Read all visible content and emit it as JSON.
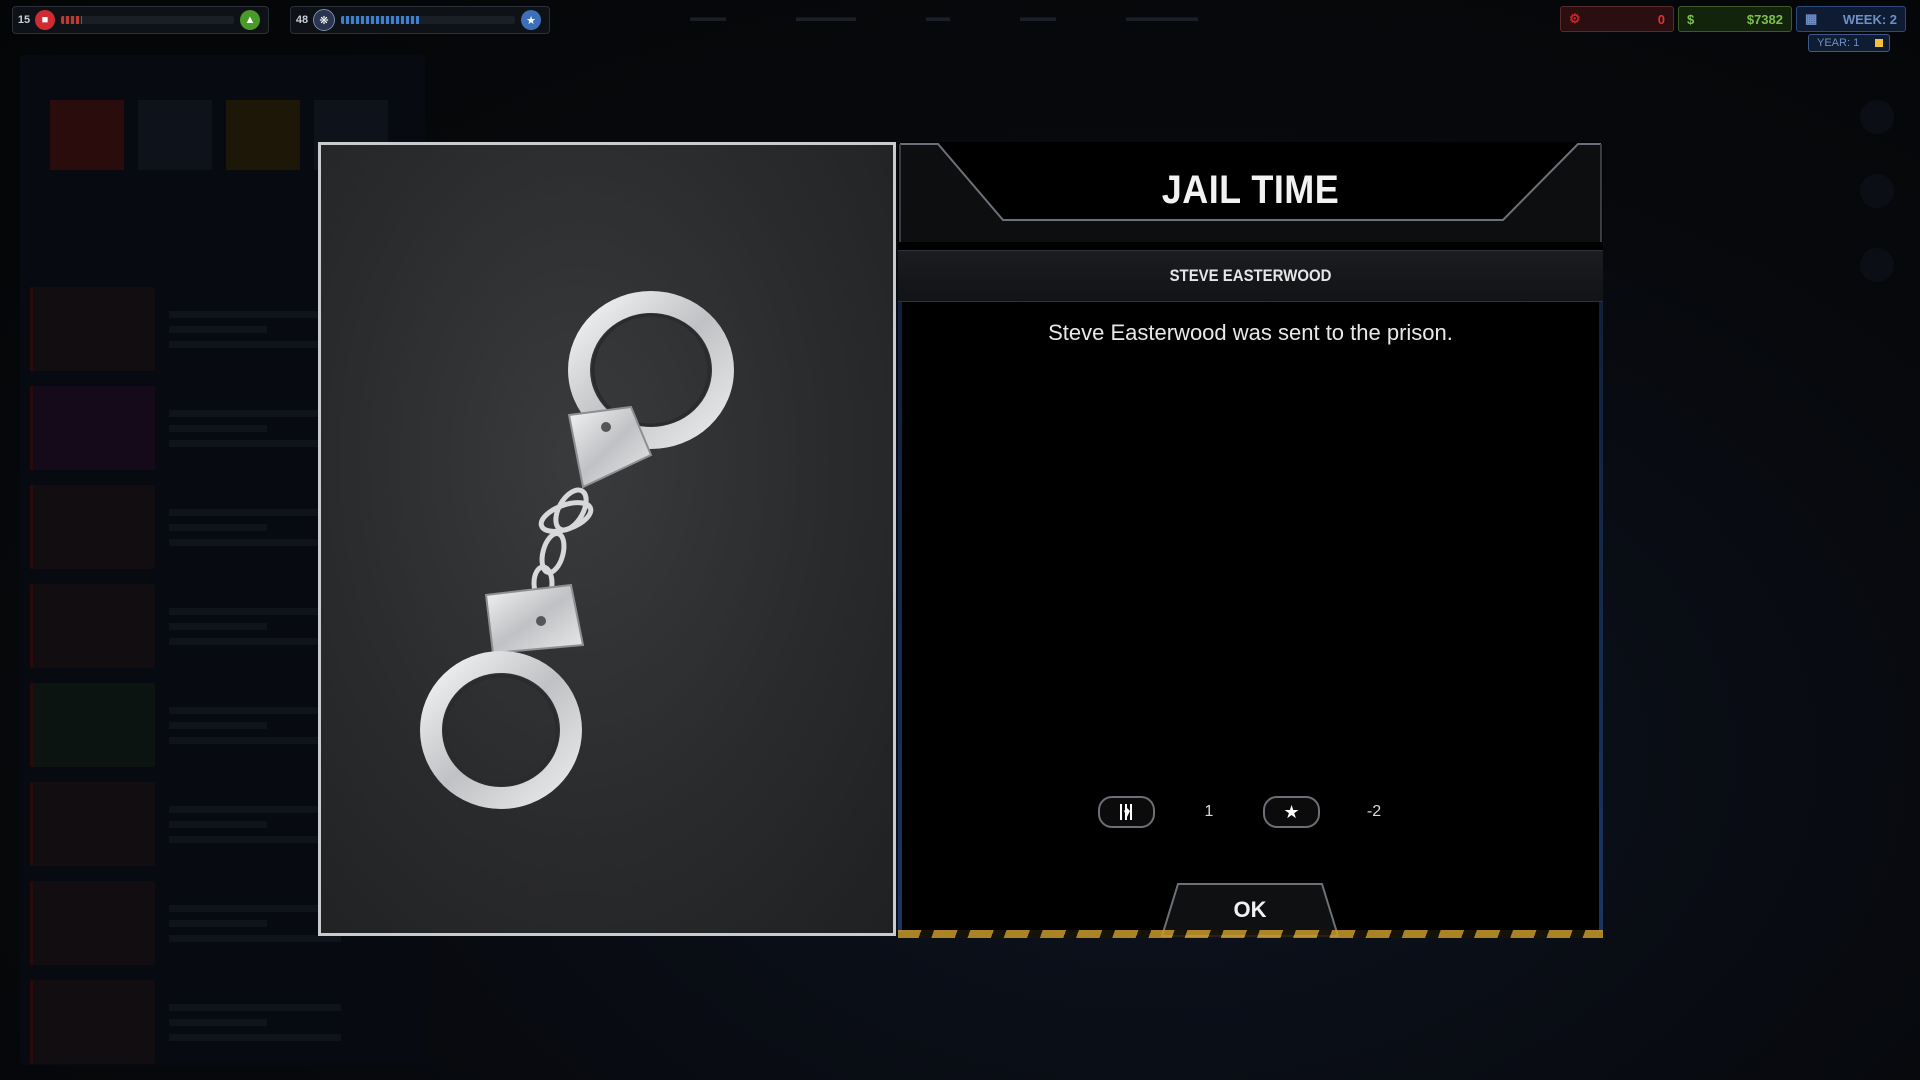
{
  "hud": {
    "wanted_level": "15",
    "fame_level": "48",
    "heat_value": "0",
    "money": "$7382",
    "week": "WEEK: 2",
    "year": "YEAR: 1",
    "colors": {
      "wanted_red": "#e0313a",
      "fame_blue": "#3d7fd0",
      "money_green": "#6ab83a",
      "week_blue": "#4b7fd0"
    }
  },
  "modal": {
    "title": "JAIL TIME",
    "character_name": "STEVE EASTERWOOD",
    "message": "Steve Easterwood was sent to the prison.",
    "rewards": [
      {
        "icon": "jail-bars-icon",
        "value": "1"
      },
      {
        "icon": "star-icon",
        "value": "-2"
      }
    ],
    "ok_label": "OK"
  }
}
